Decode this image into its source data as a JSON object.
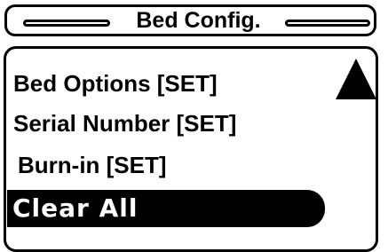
{
  "header": {
    "title": "Bed Config."
  },
  "menu": {
    "items": [
      {
        "label": "Bed Options [SET]",
        "selected": false
      },
      {
        "label": "Serial Number [SET]",
        "selected": false
      },
      {
        "label": "Burn-in [SET]",
        "selected": false
      },
      {
        "label": "Clear All",
        "selected": true
      }
    ],
    "scroll_icon": "triangle-up-icon"
  },
  "colors": {
    "foreground": "#000000",
    "background": "#ffffff",
    "selected_background": "#000000",
    "selected_text": "#ffffff"
  }
}
